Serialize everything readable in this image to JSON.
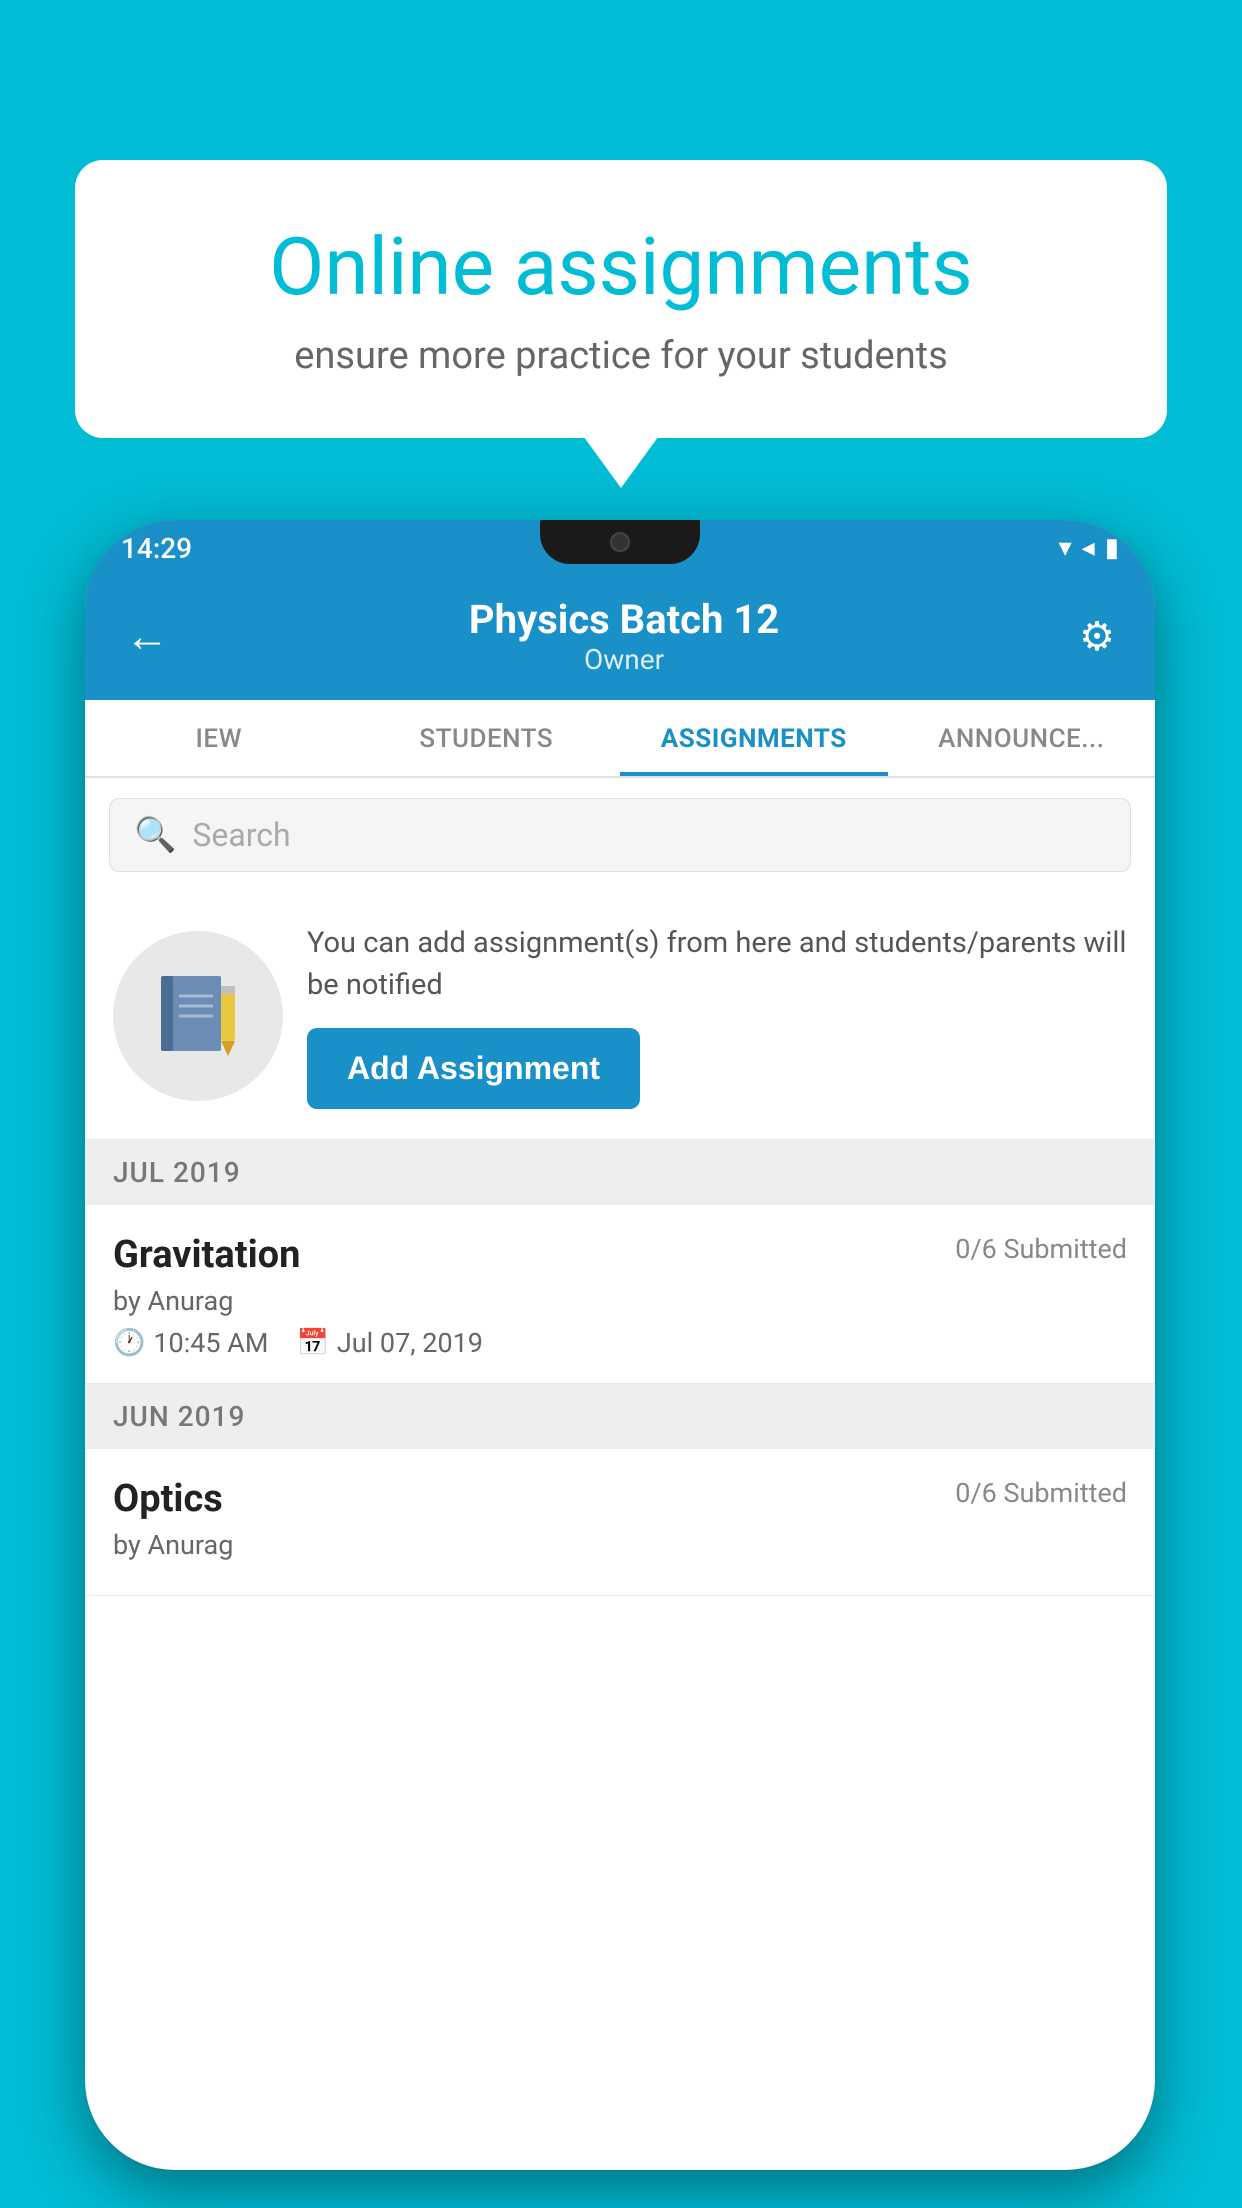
{
  "background": {
    "color": "#00bcd4"
  },
  "speech_bubble": {
    "title": "Online assignments",
    "subtitle": "ensure more practice for your students"
  },
  "status_bar": {
    "time": "14:29",
    "icons": "▾◂▮"
  },
  "header": {
    "title": "Physics Batch 12",
    "subtitle": "Owner",
    "back_label": "←",
    "settings_label": "⚙"
  },
  "tabs": [
    {
      "label": "IEW",
      "active": false
    },
    {
      "label": "STUDENTS",
      "active": false
    },
    {
      "label": "ASSIGNMENTS",
      "active": true
    },
    {
      "label": "ANNOUNCEMENTS",
      "active": false
    }
  ],
  "search": {
    "placeholder": "Search"
  },
  "promo": {
    "description": "You can add assignment(s) from here and students/parents will be notified",
    "button_label": "Add Assignment"
  },
  "sections": [
    {
      "header": "JUL 2019",
      "assignments": [
        {
          "name": "Gravitation",
          "submitted": "0/6 Submitted",
          "by": "by Anurag",
          "time": "10:45 AM",
          "date": "Jul 07, 2019"
        }
      ]
    },
    {
      "header": "JUN 2019",
      "assignments": [
        {
          "name": "Optics",
          "submitted": "0/6 Submitted",
          "by": "by Anurag",
          "time": "",
          "date": ""
        }
      ]
    }
  ]
}
